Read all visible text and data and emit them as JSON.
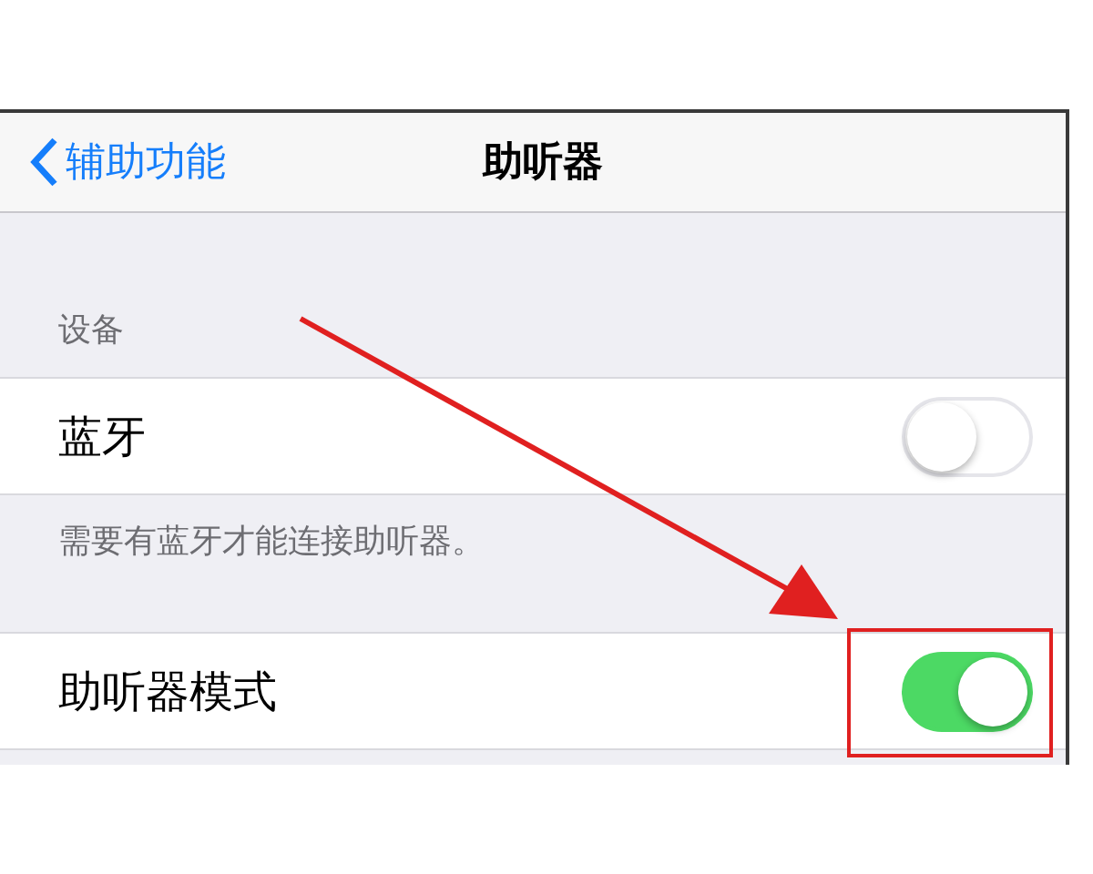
{
  "nav": {
    "back_label": "辅助功能",
    "title": "助听器"
  },
  "sections": [
    {
      "header": "设备",
      "rows": [
        {
          "label": "蓝牙",
          "on": false
        }
      ],
      "footer": "需要有蓝牙才能连接助听器。"
    },
    {
      "rows": [
        {
          "label": "助听器模式",
          "on": true
        }
      ]
    }
  ]
}
